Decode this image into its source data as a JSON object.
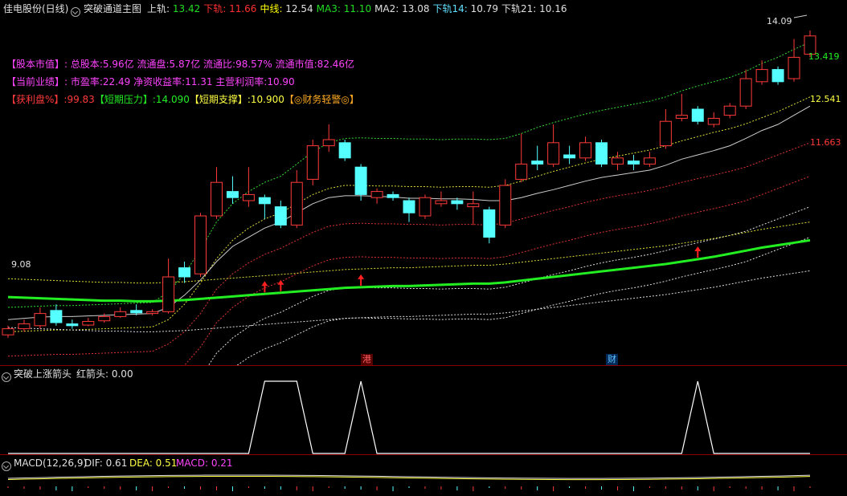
{
  "header": {
    "title": "佳电股份(日线)",
    "indicator": "突破通道主图",
    "fields": [
      {
        "label": "上轨",
        "value": "13.42",
        "color": "#e0e0e0",
        "vcolor": "#22dd22"
      },
      {
        "label": "下轨",
        "value": "11.66",
        "color": "#ff3030",
        "vcolor": "#ff3030"
      },
      {
        "label": "中线",
        "value": "12.54",
        "color": "#ffff00",
        "vcolor": "#e0e0e0"
      },
      {
        "label": "MA3",
        "value": "11.10",
        "color": "#22dd22",
        "vcolor": "#22dd22"
      },
      {
        "label": "MA2",
        "value": "13.08",
        "color": "#e0e0e0",
        "vcolor": "#e0e0e0"
      },
      {
        "label": "下轨14",
        "value": "10.79",
        "color": "#60e0ff",
        "vcolor": "#e0e0e0"
      },
      {
        "label": "下轨21",
        "value": "10.16",
        "color": "#e0e0e0",
        "vcolor": "#e0e0e0"
      }
    ]
  },
  "info": {
    "line1_head": "【股本市值】:",
    "line1_body": "总股本:5.96亿 流通盘:5.87亿 流通比:98.57% 流通市值:82.46亿",
    "line2_head": "【当前业绩】:",
    "line2_body": "市盈率:22.49 净资收益率:11.31 主营利润率:10.90",
    "line3_a": "【获利盘%】:99.83",
    "line3_b": "【短期压力】:14.090",
    "line3_c": "【短期支撑】:10.900",
    "line3_d": "【◎财务轻警◎】"
  },
  "price_labels": {
    "high": "14.09",
    "low": "9.08",
    "upper": "13.419",
    "mid": "12.541",
    "lower": "11.663"
  },
  "markers": {
    "hk": "港",
    "fin": "财"
  },
  "sub": {
    "title": "突破上涨箭头",
    "field": "红箭头: 0.00"
  },
  "macd": {
    "title": "MACD(12,26,9)",
    "dif": "DIF: 0.61",
    "dea": "DEA: 0.51",
    "macd": "MACD: 0.21"
  },
  "colors": {
    "up": "#ff3a3a",
    "down": "#5ff",
    "bold_ma": "#22ee22"
  },
  "chart_data": {
    "type": "candlestick",
    "ylim": [
      8.8,
      14.3
    ],
    "candles": [
      {
        "o": 9.1,
        "c": 9.2,
        "h": 9.25,
        "l": 9.05
      },
      {
        "o": 9.2,
        "c": 9.28,
        "h": 9.35,
        "l": 9.15
      },
      {
        "o": 9.25,
        "c": 9.45,
        "h": 9.55,
        "l": 9.2
      },
      {
        "o": 9.5,
        "c": 9.3,
        "h": 9.6,
        "l": 9.25
      },
      {
        "o": 9.28,
        "c": 9.25,
        "h": 9.35,
        "l": 9.2
      },
      {
        "o": 9.26,
        "c": 9.32,
        "h": 9.38,
        "l": 9.24
      },
      {
        "o": 9.33,
        "c": 9.4,
        "h": 9.45,
        "l": 9.3
      },
      {
        "o": 9.4,
        "c": 9.48,
        "h": 9.55,
        "l": 9.38
      },
      {
        "o": 9.5,
        "c": 9.46,
        "h": 9.6,
        "l": 9.42
      },
      {
        "o": 9.45,
        "c": 9.48,
        "h": 9.52,
        "l": 9.42
      },
      {
        "o": 9.48,
        "c": 10.05,
        "h": 10.35,
        "l": 9.45
      },
      {
        "o": 10.2,
        "c": 10.05,
        "h": 10.3,
        "l": 9.95
      },
      {
        "o": 10.1,
        "c": 11.05,
        "h": 11.1,
        "l": 10.05
      },
      {
        "o": 11.05,
        "c": 11.6,
        "h": 11.85,
        "l": 11.0
      },
      {
        "o": 11.45,
        "c": 11.35,
        "h": 11.7,
        "l": 11.25
      },
      {
        "o": 11.3,
        "c": 11.4,
        "h": 11.85,
        "l": 11.2
      },
      {
        "o": 11.35,
        "c": 11.25,
        "h": 11.4,
        "l": 11.0
      },
      {
        "o": 11.2,
        "c": 10.9,
        "h": 11.3,
        "l": 10.85
      },
      {
        "o": 10.9,
        "c": 11.6,
        "h": 11.8,
        "l": 10.85
      },
      {
        "o": 11.65,
        "c": 12.2,
        "h": 12.3,
        "l": 11.55
      },
      {
        "o": 12.2,
        "c": 12.3,
        "h": 12.55,
        "l": 12.1
      },
      {
        "o": 12.25,
        "c": 12.0,
        "h": 12.3,
        "l": 11.95
      },
      {
        "o": 11.85,
        "c": 11.4,
        "h": 11.9,
        "l": 11.3
      },
      {
        "o": 11.35,
        "c": 11.45,
        "h": 11.5,
        "l": 11.25
      },
      {
        "o": 11.4,
        "c": 11.35,
        "h": 11.45,
        "l": 11.3
      },
      {
        "o": 11.3,
        "c": 11.1,
        "h": 11.35,
        "l": 10.95
      },
      {
        "o": 11.05,
        "c": 11.35,
        "h": 11.4,
        "l": 11.0
      },
      {
        "o": 11.25,
        "c": 11.3,
        "h": 11.45,
        "l": 11.2
      },
      {
        "o": 11.3,
        "c": 11.25,
        "h": 11.35,
        "l": 11.15
      },
      {
        "o": 11.2,
        "c": 11.25,
        "h": 11.45,
        "l": 10.9
      },
      {
        "o": 11.15,
        "c": 10.7,
        "h": 11.2,
        "l": 10.6
      },
      {
        "o": 10.9,
        "c": 11.55,
        "h": 11.65,
        "l": 10.85
      },
      {
        "o": 11.65,
        "c": 11.9,
        "h": 12.4,
        "l": 11.6
      },
      {
        "o": 11.95,
        "c": 11.9,
        "h": 12.2,
        "l": 11.8
      },
      {
        "o": 11.9,
        "c": 12.25,
        "h": 12.55,
        "l": 11.85
      },
      {
        "o": 12.05,
        "c": 12.0,
        "h": 12.2,
        "l": 11.9
      },
      {
        "o": 12.0,
        "c": 12.25,
        "h": 12.35,
        "l": 11.95
      },
      {
        "o": 12.25,
        "c": 11.9,
        "h": 12.3,
        "l": 11.85
      },
      {
        "o": 11.9,
        "c": 12.0,
        "h": 12.1,
        "l": 11.8
      },
      {
        "o": 11.95,
        "c": 11.9,
        "h": 12.05,
        "l": 11.8
      },
      {
        "o": 11.9,
        "c": 12.0,
        "h": 12.1,
        "l": 11.85
      },
      {
        "o": 12.2,
        "c": 12.6,
        "h": 12.8,
        "l": 12.15
      },
      {
        "o": 12.65,
        "c": 12.7,
        "h": 13.05,
        "l": 12.6
      },
      {
        "o": 12.8,
        "c": 12.6,
        "h": 12.85,
        "l": 12.55
      },
      {
        "o": 12.55,
        "c": 12.65,
        "h": 12.75,
        "l": 12.5
      },
      {
        "o": 12.7,
        "c": 12.85,
        "h": 12.9,
        "l": 12.65
      },
      {
        "o": 12.85,
        "c": 13.3,
        "h": 13.45,
        "l": 12.8
      },
      {
        "o": 13.25,
        "c": 13.45,
        "h": 13.6,
        "l": 13.2
      },
      {
        "o": 13.45,
        "c": 13.25,
        "h": 13.5,
        "l": 13.2
      },
      {
        "o": 13.3,
        "c": 13.65,
        "h": 13.95,
        "l": 13.25
      },
      {
        "o": 13.7,
        "c": 14.0,
        "h": 14.09,
        "l": 13.65
      }
    ],
    "bold_ma": [
      9.72,
      9.71,
      9.7,
      9.69,
      9.68,
      9.67,
      9.66,
      9.66,
      9.65,
      9.65,
      9.66,
      9.67,
      9.69,
      9.71,
      9.73,
      9.75,
      9.77,
      9.79,
      9.81,
      9.83,
      9.85,
      9.87,
      9.88,
      9.89,
      9.9,
      9.9,
      9.91,
      9.92,
      9.93,
      9.94,
      9.94,
      9.96,
      9.99,
      10.02,
      10.05,
      10.08,
      10.11,
      10.14,
      10.17,
      10.2,
      10.23,
      10.26,
      10.3,
      10.34,
      10.38,
      10.43,
      10.48,
      10.53,
      10.57,
      10.61,
      10.65
    ],
    "ma2": [
      9.35,
      9.37,
      9.39,
      9.4,
      9.4,
      9.41,
      9.42,
      9.43,
      9.44,
      9.45,
      9.55,
      9.75,
      10.0,
      10.3,
      10.55,
      10.7,
      10.85,
      10.95,
      11.1,
      11.25,
      11.35,
      11.38,
      11.38,
      11.37,
      11.36,
      11.34,
      11.34,
      11.33,
      11.33,
      11.32,
      11.3,
      11.3,
      11.35,
      11.42,
      11.48,
      11.55,
      11.62,
      11.68,
      11.72,
      11.76,
      11.8,
      11.88,
      11.98,
      12.05,
      12.12,
      12.2,
      12.32,
      12.45,
      12.55,
      12.7,
      12.85
    ],
    "upper_band": [
      9.55,
      9.56,
      9.57,
      9.58,
      9.58,
      9.59,
      9.6,
      9.61,
      9.62,
      9.63,
      9.8,
      10.1,
      10.5,
      10.95,
      11.25,
      11.45,
      11.6,
      11.7,
      11.9,
      12.1,
      12.25,
      12.32,
      12.33,
      12.32,
      12.32,
      12.31,
      12.31,
      12.3,
      12.31,
      12.31,
      12.3,
      12.32,
      12.4,
      12.5,
      12.58,
      12.65,
      12.72,
      12.78,
      12.83,
      12.88,
      12.93,
      13.0,
      13.1,
      13.18,
      13.25,
      13.32,
      13.42,
      13.55,
      13.65,
      13.78,
      13.9
    ],
    "mid_band": [
      9.15,
      9.16,
      9.17,
      9.18,
      9.18,
      9.19,
      9.2,
      9.21,
      9.22,
      9.23,
      9.35,
      9.6,
      9.95,
      10.35,
      10.65,
      10.85,
      11.0,
      11.1,
      11.25,
      11.4,
      11.5,
      11.55,
      11.55,
      11.54,
      11.54,
      11.53,
      11.53,
      11.52,
      11.53,
      11.53,
      11.52,
      11.55,
      11.62,
      11.7,
      11.78,
      11.85,
      11.92,
      11.98,
      12.03,
      12.08,
      12.13,
      12.2,
      12.28,
      12.35,
      12.42,
      12.48,
      12.56,
      12.66,
      12.76,
      12.88,
      13.0
    ],
    "lower_band": [
      8.75,
      8.76,
      8.77,
      8.78,
      8.78,
      8.79,
      8.8,
      8.81,
      8.82,
      8.83,
      8.95,
      9.15,
      9.45,
      9.85,
      10.1,
      10.28,
      10.42,
      10.52,
      10.65,
      10.78,
      10.88,
      10.92,
      10.93,
      10.92,
      10.92,
      10.91,
      10.91,
      10.9,
      10.91,
      10.91,
      10.9,
      10.93,
      11.0,
      11.07,
      11.14,
      11.2,
      11.27,
      11.33,
      11.38,
      11.42,
      11.47,
      11.53,
      11.6,
      11.66,
      11.72,
      11.78,
      11.85,
      11.95,
      12.05,
      12.15,
      12.25
    ],
    "arrows": [
      16,
      17,
      22,
      43
    ],
    "sub_signal": [
      0,
      0,
      0,
      0,
      0,
      0,
      0,
      0,
      0,
      0,
      0,
      0,
      0,
      0,
      0,
      0,
      1,
      1,
      1,
      0,
      0,
      0,
      1,
      0,
      0,
      0,
      0,
      0,
      0,
      0,
      0,
      0,
      0,
      0,
      0,
      0,
      0,
      0,
      0,
      0,
      0,
      0,
      0,
      1,
      0,
      0,
      0,
      0,
      0,
      0,
      0
    ]
  }
}
